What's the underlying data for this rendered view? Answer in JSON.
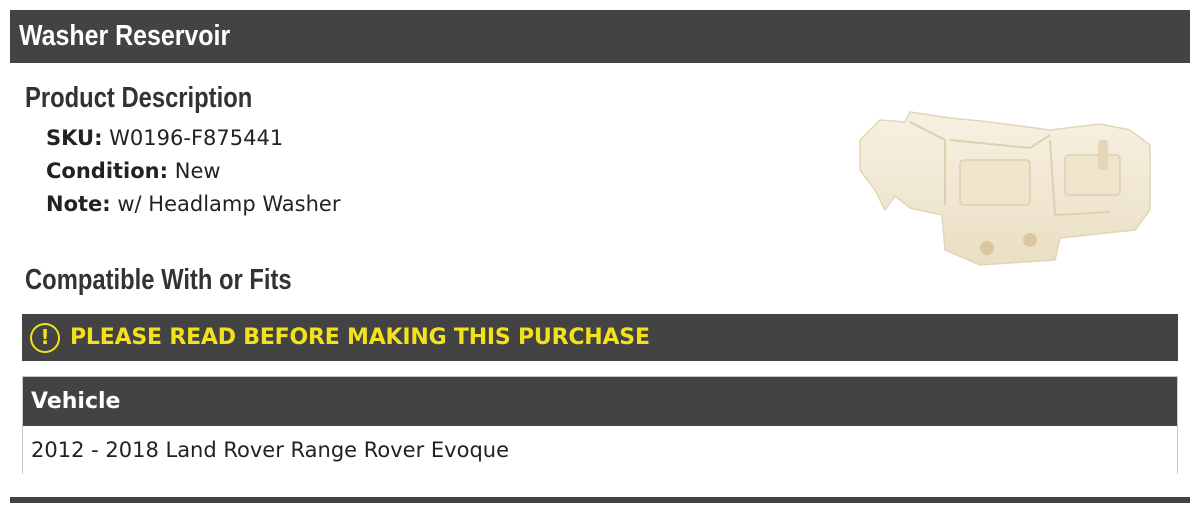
{
  "header": {
    "title": "Washer Reservoir"
  },
  "product_description": {
    "heading": "Product Description",
    "specs": [
      {
        "label": "SKU:",
        "value": "W0196-F875441"
      },
      {
        "label": "Condition:",
        "value": "New"
      },
      {
        "label": "Note:",
        "value": "w/ Headlamp Washer"
      }
    ]
  },
  "compatibility": {
    "heading": "Compatible With or Fits",
    "notice": {
      "icon": "alert-circle-icon",
      "text": "PLEASE READ BEFORE MAKING THIS PURCHASE",
      "color": "#f3e21b"
    },
    "table": {
      "header": "Vehicle",
      "rows": [
        "2012 - 2018 Land Rover Range Rover Evoque"
      ]
    }
  },
  "colors": {
    "bar": "#434343",
    "accent": "#f3e21b",
    "part": "#f4ecd8"
  }
}
